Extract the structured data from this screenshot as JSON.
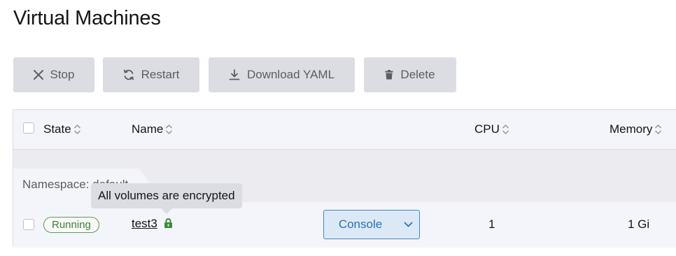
{
  "page": {
    "title": "Virtual Machines"
  },
  "toolbar": {
    "stop_label": "Stop",
    "restart_label": "Restart",
    "download_yaml_label": "Download YAML",
    "delete_label": "Delete"
  },
  "table": {
    "columns": [
      {
        "label": "State",
        "sortable": true
      },
      {
        "label": "Name",
        "sortable": true
      },
      {
        "label": "CPU",
        "sortable": true
      },
      {
        "label": "Memory",
        "sortable": true
      }
    ],
    "group": {
      "label": "Namespace: default"
    },
    "rows": [
      {
        "state": "Running",
        "name": "test3",
        "console_label": "Console",
        "cpu": "1",
        "memory": "1 Gi",
        "encrypted": true
      }
    ]
  },
  "tooltip": {
    "text": "All volumes are encrypted"
  },
  "colors": {
    "running_badge": "#3e7d38",
    "console_accent": "#2c6fb7",
    "lock_icon": "#3e8a3a",
    "button_bg": "#dcdde2"
  }
}
